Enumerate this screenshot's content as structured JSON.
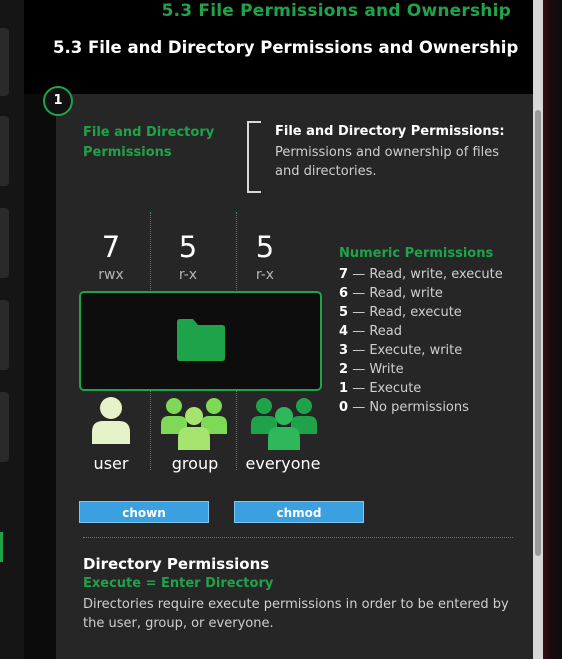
{
  "header": {
    "top_title": "5.3 File Permissions and Ownership",
    "section_title": "5.3 File and Directory Permissions and Ownership"
  },
  "step": {
    "number": "1"
  },
  "definition": {
    "label": "File and Directory Permissions",
    "title": "File and Directory Permissions:",
    "body": "Permissions and ownership of files and directories."
  },
  "permissions": [
    {
      "digit": "7",
      "rwx": "rwx",
      "who": "user"
    },
    {
      "digit": "5",
      "rwx": "r-x",
      "who": "group"
    },
    {
      "digit": "5",
      "rwx": "r-x",
      "who": "everyone"
    }
  ],
  "numeric": {
    "title": "Numeric Permissions",
    "items": [
      {
        "num": "7",
        "desc": "— Read, write, execute"
      },
      {
        "num": "6",
        "desc": "— Read, write"
      },
      {
        "num": "5",
        "desc": "— Read, execute"
      },
      {
        "num": "4",
        "desc": "— Read"
      },
      {
        "num": "3",
        "desc": "— Execute, write"
      },
      {
        "num": "2",
        "desc": "— Write"
      },
      {
        "num": "1",
        "desc": "— Execute"
      },
      {
        "num": "0",
        "desc": "— No permissions"
      }
    ]
  },
  "buttons": {
    "chown": "chown",
    "chmod": "chmod"
  },
  "directory": {
    "title": "Directory Permissions",
    "subtitle": "Execute = Enter Directory",
    "body": "Directories require execute permissions in order to be entered by the user, group, or everyone."
  },
  "colors": {
    "accent_green": "#1fa34a",
    "button_blue": "#3aa0e0",
    "panel_bg": "#262626"
  },
  "icons": {
    "folder": "folder-icon",
    "user": "user-icon",
    "group": "group-icon",
    "everyone": "everyone-icon"
  }
}
